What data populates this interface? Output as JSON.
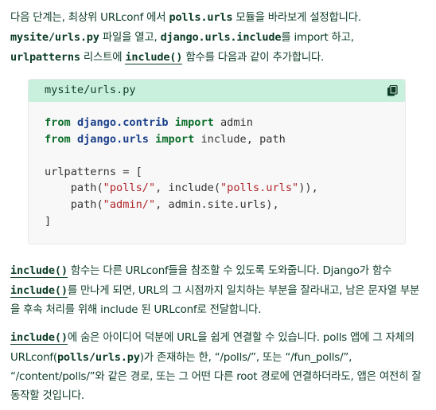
{
  "intro": {
    "t1": "다음 단계는, 최상위 URLconf 에서 ",
    "c1": "polls.urls",
    "t2": " 모듈을 바라보게 설정합니다.",
    "c2": "mysite/urls.py",
    "t3": " 파일을 열고, ",
    "c3": "django.urls.include",
    "t4": "를 import 하고,",
    "c4": "urlpatterns",
    "t5": " 리스트에 ",
    "c5": "include()",
    "t6": " 함수를 다음과 같이 추가합니다."
  },
  "snippet": {
    "filename": "mysite/urls.py",
    "copy_icon": "copy-icon",
    "lines": {
      "l1": {
        "kw1": "from",
        "mod": "django.contrib",
        "kw2": "import",
        "rest": " admin"
      },
      "l2": {
        "kw1": "from",
        "mod": "django.urls",
        "kw2": "import",
        "rest": " include, path"
      },
      "l4": {
        "text": "urlpatterns = ["
      },
      "l5": {
        "a": "    path(",
        "s1": "\"polls/\"",
        "b": ", include(",
        "s2": "\"polls.urls\"",
        "c": ")),"
      },
      "l6": {
        "a": "    path(",
        "s1": "\"admin/\"",
        "b": ", admin.site.urls),"
      },
      "l7": {
        "text": "]"
      }
    }
  },
  "para2": {
    "c1": "include()",
    "t1": " 함수는 다른 URLconf들을 참조할 수 있도록 도와줍니다. Django가 함수",
    "c2": "include()",
    "t2": "를 만나게 되면, URL의 그 시점까지 일치하는 부분을 잘라내고, 남은 문자열 부분을 후속 처리를 위해 include 된 URLconf로 전달합니다."
  },
  "para3": {
    "c1": "include()",
    "t1": "에 숨은 아이디어 덕분에 URL을 쉽게 연결할 수 있습니다. polls 앱에 그 자체의 URLconf(",
    "c2": "polls/urls.py",
    "t2": ")가 존재하는 한, “/polls/”, 또는 “/fun_polls/”, “/content/polls/”와 같은 경로, 또는 그 어떤 다른 root 경로에 연결하더라도, 앱은 여전히 잘 동작할 것입니다."
  }
}
